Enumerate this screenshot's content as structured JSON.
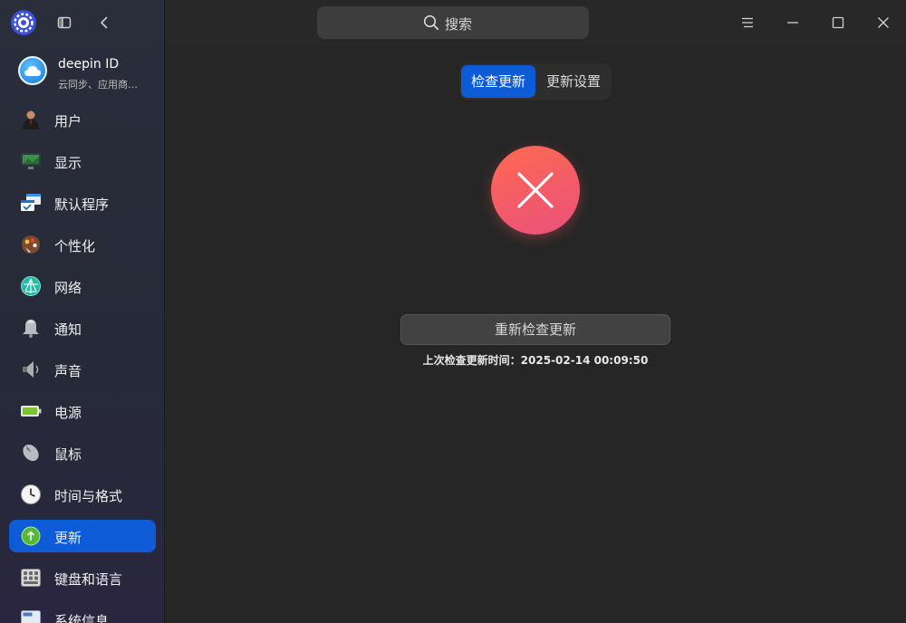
{
  "sidebar": {
    "account": {
      "name": "deepin ID",
      "subtitle": "云同步、应用商…"
    },
    "items": [
      {
        "label": "用户",
        "icon": "user-icon"
      },
      {
        "label": "显示",
        "icon": "display-icon"
      },
      {
        "label": "默认程序",
        "icon": "default-apps-icon"
      },
      {
        "label": "个性化",
        "icon": "personalization-icon"
      },
      {
        "label": "网络",
        "icon": "network-icon"
      },
      {
        "label": "通知",
        "icon": "bell-icon"
      },
      {
        "label": "声音",
        "icon": "speaker-icon"
      },
      {
        "label": "电源",
        "icon": "battery-icon"
      },
      {
        "label": "鼠标",
        "icon": "mouse-icon"
      },
      {
        "label": "时间与格式",
        "icon": "clock-icon"
      },
      {
        "label": "更新",
        "icon": "update-icon",
        "active": true
      },
      {
        "label": "键盘和语言",
        "icon": "keyboard-icon"
      },
      {
        "label": "系统信息",
        "icon": "info-icon"
      }
    ]
  },
  "titlebar": {
    "search_placeholder": "搜索"
  },
  "tabs": {
    "check": "检查更新",
    "settings": "更新设置"
  },
  "status": {
    "state": "error",
    "button_label": "重新检查更新",
    "last_check_label": "上次检查更新时间：2025-02-14 00:09:50"
  },
  "colors": {
    "accent": "#0d5bd7",
    "error_top": "#ff6a4f",
    "error_bottom": "#e8527c"
  }
}
